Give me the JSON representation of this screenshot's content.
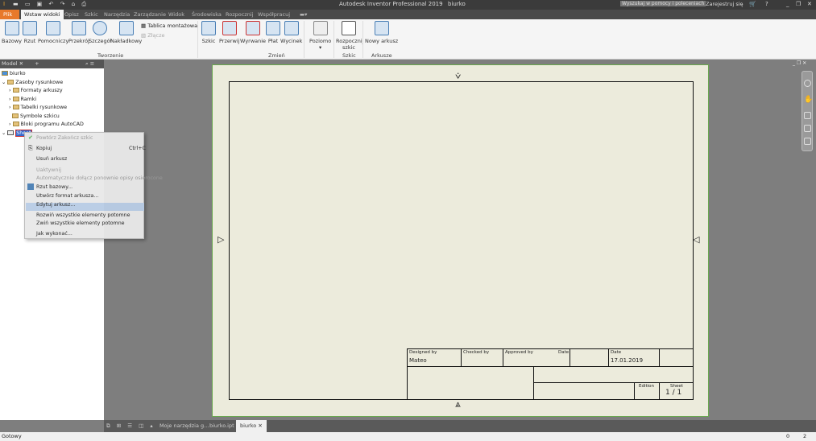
{
  "app": {
    "title": "Autodesk Inventor Professional 2019",
    "document": "biurko",
    "search_placeholder": "Wyszukaj w pomocy i poleceniach",
    "sign_in": "Zarejestruj się"
  },
  "ribbon": {
    "tabs": [
      "Plik",
      "Wstaw widoki",
      "Opisz",
      "Szkic",
      "Narzędzia",
      "Zarządzanie",
      "Widok",
      "Środowiska",
      "Rozpocznij",
      "Współpracuj"
    ],
    "buttons": [
      "Bazowy",
      "Rzut",
      "Pomocniczy",
      "Przekrój",
      "Szczegół",
      "Nakładkowy",
      "Szkic",
      "Przerwij",
      "Wyrwanie",
      "Płat",
      "Wycinek",
      "Poziomo",
      "Rozpocznij szkic",
      "Nowy arkusz"
    ],
    "small": [
      "Tablica montażowa",
      "Złącze"
    ],
    "groups": [
      "Tworzenie",
      "Zmień",
      "Szkic",
      "Arkusze"
    ]
  },
  "browser": {
    "tab": "Model",
    "root": "biurko",
    "items": [
      "Zasoby rysunkowe",
      "Formaty arkuszy",
      "Ramki",
      "Tabelki rysunkowe",
      "Symbole szkicu",
      "Bloki programu AutoCAD",
      "Sheet"
    ]
  },
  "menu": {
    "items": [
      {
        "label": "Powtórz Zakończ szkic",
        "disabled": true
      },
      {
        "label": "Kopiuj",
        "shortcut": "Ctrl+C"
      },
      {
        "label": "Usuń arkusz"
      },
      {
        "label": "Uaktywnij",
        "disabled": true
      },
      {
        "label": "Automatycznie dołącz ponownie opisy osierocone",
        "disabled": true
      },
      {
        "label": "Rzut bazowy..."
      },
      {
        "label": "Utwórz format arkusza..."
      },
      {
        "label": "Edytuj arkusz..."
      },
      {
        "label": "Rozwiń wszystkie elementy potomne"
      },
      {
        "label": "Zwiń wszystkie elementy potomne"
      },
      {
        "label": "Jak wykonać..."
      }
    ]
  },
  "titleblock": {
    "designed_by_label": "Designed by",
    "designed_by": "Mateo",
    "checked_by_label": "Checked by",
    "approved_by_label": "Approved by",
    "date_label": "Date",
    "date2_label": "Date",
    "date": "17.01.2019",
    "edition_label": "Edition",
    "sheet_label": "Sheet",
    "sheet": "1 / 1"
  },
  "bottom_tabs": [
    "Moje narzędzia g...",
    "biurko.ipt",
    "biurko"
  ],
  "status": {
    "text": "Gotowy",
    "n1": "0",
    "n2": "2"
  }
}
